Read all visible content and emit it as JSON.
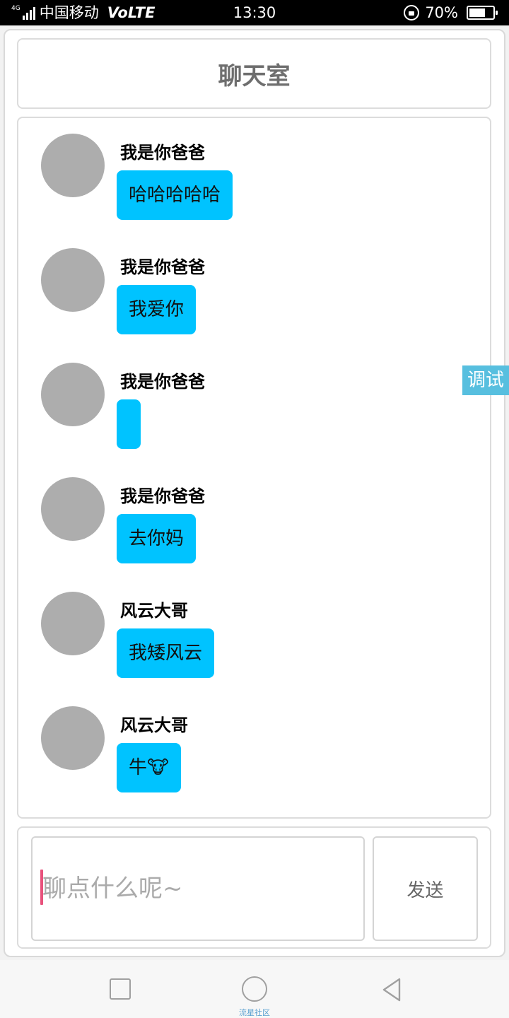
{
  "status_bar": {
    "signal_tag": "4G",
    "carrier": "中国移动",
    "network": "VoLTE",
    "time": "13:30",
    "battery_text": "70%",
    "battery_level": 0.7
  },
  "header": {
    "title": "聊天室"
  },
  "messages": [
    {
      "sender": "我是你爸爸",
      "text": "哈哈哈哈哈"
    },
    {
      "sender": "我是你爸爸",
      "text": "我爱你"
    },
    {
      "sender": "我是你爸爸",
      "text": ""
    },
    {
      "sender": "我是你爸爸",
      "text": "去你妈"
    },
    {
      "sender": "风云大哥",
      "text": "我矮风云"
    },
    {
      "sender": "风云大哥",
      "text": "牛🐮"
    }
  ],
  "debug_tab": {
    "label": "调试"
  },
  "input_area": {
    "placeholder": "聊点什么呢~",
    "value": "",
    "send_label": "发送"
  },
  "nav_bar": {
    "caption": "流星社区"
  },
  "colors": {
    "bubble": "#00c3ff",
    "avatar": "#adadad",
    "debug_tab": "#57bfdf",
    "caret": "#e8527c"
  }
}
